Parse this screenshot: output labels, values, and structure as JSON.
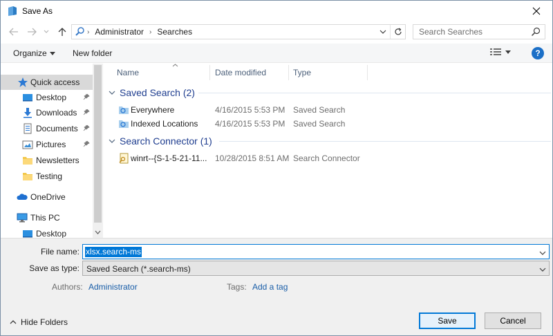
{
  "window": {
    "title": "Save As",
    "icon": "folder-icon",
    "close_glyph": "✕"
  },
  "address": {
    "crumbs": [
      "Administrator",
      "Searches"
    ],
    "separator": "›"
  },
  "search": {
    "placeholder": "Search Searches"
  },
  "toolbar": {
    "organize_label": "Organize",
    "new_folder_label": "New folder",
    "help_glyph": "?"
  },
  "sidebar": {
    "items": [
      {
        "label": "Quick access",
        "icon": "star-icon",
        "selected": true
      },
      {
        "label": "Desktop",
        "icon": "desktop-icon",
        "pinned": true
      },
      {
        "label": "Downloads",
        "icon": "download-icon",
        "pinned": true
      },
      {
        "label": "Documents",
        "icon": "documents-icon",
        "pinned": true
      },
      {
        "label": "Pictures",
        "icon": "pictures-icon",
        "pinned": true
      },
      {
        "label": "Newsletters",
        "icon": "folder-icon"
      },
      {
        "label": "Testing",
        "icon": "folder-icon"
      },
      {
        "label": "OneDrive",
        "icon": "cloud-icon"
      },
      {
        "label": "This PC",
        "icon": "computer-icon"
      },
      {
        "label": "Desktop",
        "icon": "desktop-icon"
      }
    ],
    "pin_glyph": "📌"
  },
  "columns": {
    "name": "Name",
    "date_modified": "Date modified",
    "type": "Type"
  },
  "groups": [
    {
      "label": "Saved Search (2)",
      "files": [
        {
          "name": "Everywhere",
          "date": "4/16/2015 5:53 PM",
          "type": "Saved Search"
        },
        {
          "name": "Indexed Locations",
          "date": "4/16/2015 5:53 PM",
          "type": "Saved Search"
        }
      ]
    },
    {
      "label": "Search Connector (1)",
      "files": [
        {
          "name": "winrt--{S-1-5-21-11...",
          "date": "10/28/2015 8:51 AM",
          "type": "Search Connector"
        }
      ]
    }
  ],
  "form": {
    "file_name_label": "File name:",
    "file_name_value": "xlsx.search-ms",
    "save_as_type_label": "Save as type:",
    "save_as_type_value": "Saved Search (*.search-ms)",
    "authors_label": "Authors:",
    "authors_value": "Administrator",
    "tags_label": "Tags:",
    "tags_value": "Add a tag"
  },
  "footer": {
    "hide_folders_label": "Hide Folders",
    "save_label": "Save",
    "cancel_label": "Cancel"
  },
  "colors": {
    "accent": "#0078d7",
    "group_header": "#1e3d8f",
    "link": "#1a5ea8"
  }
}
